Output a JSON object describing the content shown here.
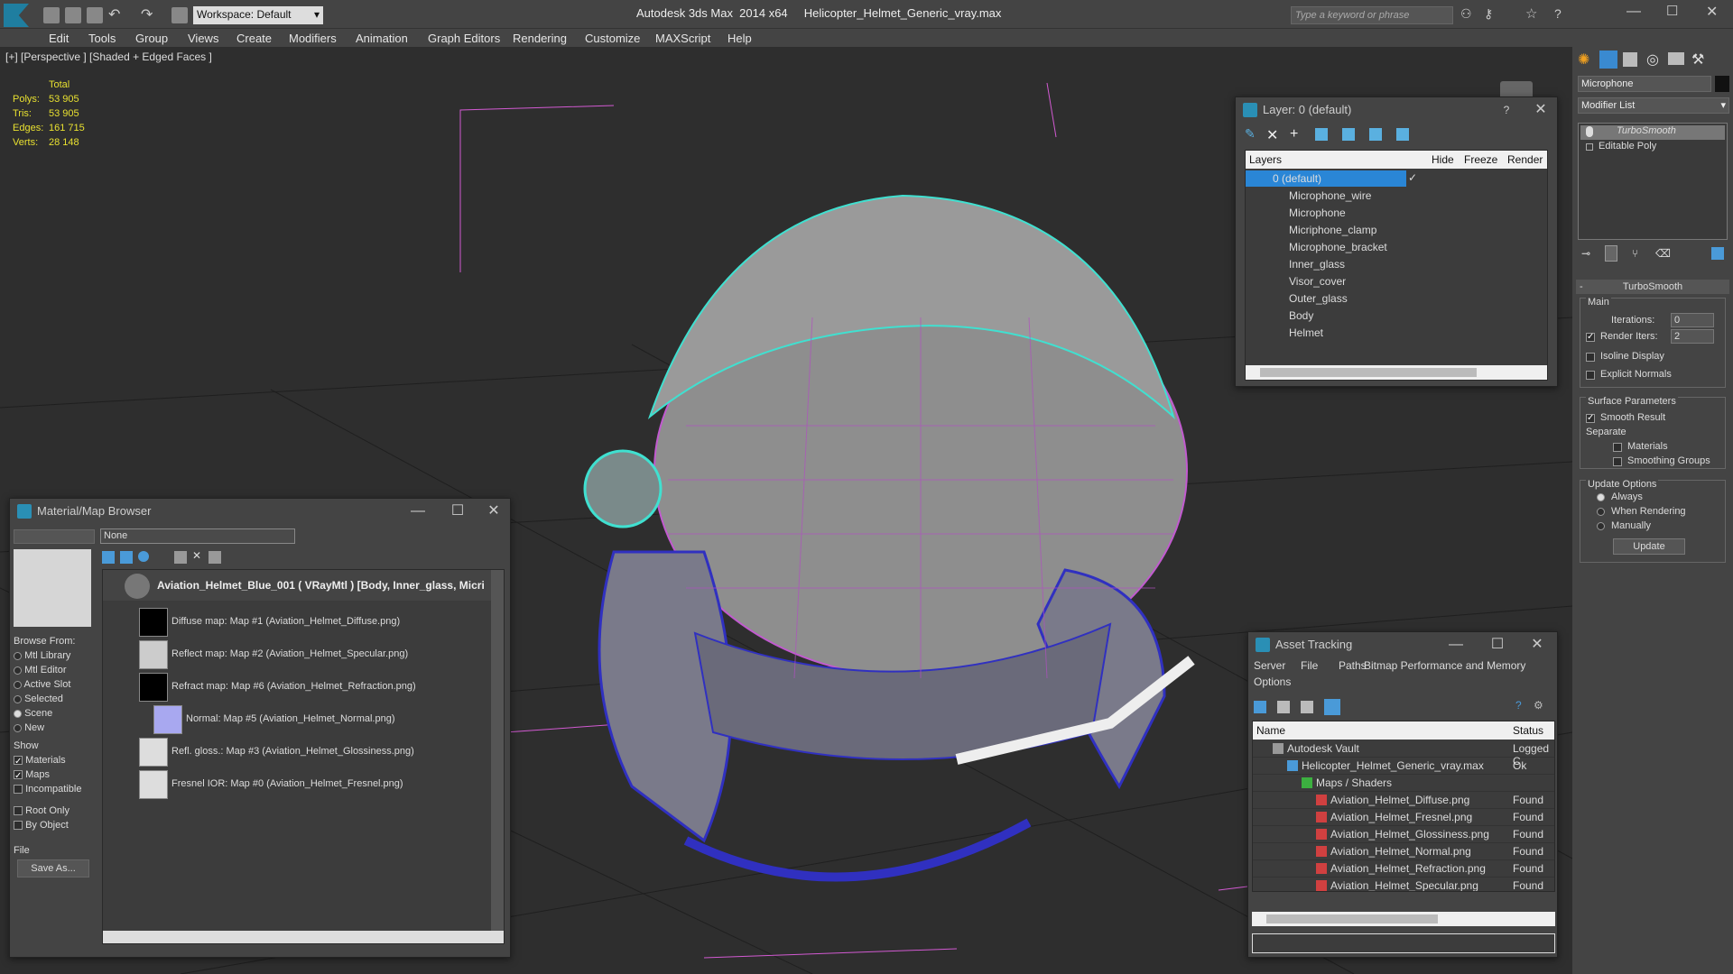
{
  "app": {
    "title": "Autodesk 3ds Max  2014 x64     Helicopter_Helmet_Generic_vray.max",
    "workspace": "Workspace: Default",
    "search_placeholder": "Type a keyword or phrase"
  },
  "menu": [
    "Edit",
    "Tools",
    "Group",
    "Views",
    "Create",
    "Modifiers",
    "Animation",
    "Graph Editors",
    "Rendering",
    "Customize",
    "MAXScript",
    "Help"
  ],
  "viewport": {
    "label": "[+] [Perspective ] [Shaded + Edged Faces ]",
    "stats": {
      "header": "Total",
      "polys_label": "Polys:",
      "polys": "53 905",
      "tris_label": "Tris:",
      "tris": "53 905",
      "edges_label": "Edges:",
      "edges": "161 715",
      "verts_label": "Verts:",
      "verts": "28 148"
    }
  },
  "layers_window": {
    "title": "Layer: 0 (default)",
    "help": "?",
    "columns": [
      "Layers",
      "Hide",
      "Freeze",
      "Render"
    ],
    "items": [
      "0 (default)",
      "Microphone_wire",
      "Microphone",
      "Micriphone_clamp",
      "Microphone_bracket",
      "Inner_glass",
      "Visor_cover",
      "Outer_glass",
      "Body",
      "Helmet"
    ]
  },
  "material_browser": {
    "title": "Material/Map Browser",
    "search_value": "None",
    "material": "Aviation_Helmet_Blue_001  ( VRayMtl ) [Body, Inner_glass, Micri",
    "maps": [
      "Diffuse map: Map #1 (Aviation_Helmet_Diffuse.png)",
      "Reflect map: Map #2 (Aviation_Helmet_Specular.png)",
      "Refract map: Map #6 (Aviation_Helmet_Refraction.png)",
      "Normal: Map #5 (Aviation_Helmet_Normal.png)",
      "Refl. gloss.: Map #3 (Aviation_Helmet_Glossiness.png)",
      "Fresnel IOR: Map #0 (Aviation_Helmet_Fresnel.png)"
    ],
    "browse_from_label": "Browse From:",
    "browse_from": [
      "Mtl Library",
      "Mtl Editor",
      "Active Slot",
      "Selected",
      "Scene",
      "New"
    ],
    "show_label": "Show",
    "show": [
      "Materials",
      "Maps",
      "Incompatible"
    ],
    "root_only": "Root Only",
    "by_object": "By Object",
    "file_label": "File",
    "save_as": "Save As..."
  },
  "asset_tracking": {
    "title": "Asset Tracking",
    "menu": [
      "Server",
      "File",
      "Paths",
      "Bitmap Performance and Memory"
    ],
    "options": "Options",
    "columns": [
      "Name",
      "Status"
    ],
    "rows": [
      {
        "name": "Autodesk Vault",
        "status": "Logged C"
      },
      {
        "name": "Helicopter_Helmet_Generic_vray.max",
        "status": "Ok"
      },
      {
        "name": "Maps / Shaders",
        "status": ""
      },
      {
        "name": "Aviation_Helmet_Diffuse.png",
        "status": "Found"
      },
      {
        "name": "Aviation_Helmet_Fresnel.png",
        "status": "Found"
      },
      {
        "name": "Aviation_Helmet_Glossiness.png",
        "status": "Found"
      },
      {
        "name": "Aviation_Helmet_Normal.png",
        "status": "Found"
      },
      {
        "name": "Aviation_Helmet_Refraction.png",
        "status": "Found"
      },
      {
        "name": "Aviation_Helmet_Specular.png",
        "status": "Found"
      }
    ]
  },
  "command_panel": {
    "object_name": "Microphone",
    "modifier_list": "Modifier List",
    "stack": [
      "TurboSmooth",
      "Editable Poly"
    ],
    "rollout_title": "TurboSmooth",
    "main_label": "Main",
    "iterations_label": "Iterations:",
    "iterations": "0",
    "render_iters_label": "Render Iters:",
    "render_iters": "2",
    "isoline": "Isoline Display",
    "explicit_normals": "Explicit Normals",
    "surface_params": "Surface Parameters",
    "smooth_result": "Smooth Result",
    "separate": "Separate",
    "materials": "Materials",
    "smoothing_groups": "Smoothing Groups",
    "update_options": "Update Options",
    "always": "Always",
    "when_rendering": "When Rendering",
    "manually": "Manually",
    "update_btn": "Update"
  }
}
